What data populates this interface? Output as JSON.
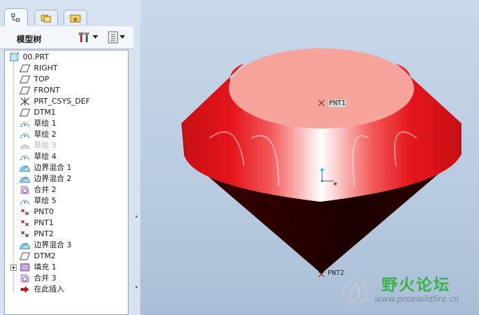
{
  "tree_panel": {
    "title": "模型树",
    "tabs": [
      {
        "name": "model-tree-tab"
      },
      {
        "name": "folder-browser-tab"
      },
      {
        "name": "favorites-tab"
      }
    ],
    "items": [
      {
        "label": "00.PRT",
        "icon": "part-icon",
        "dim": false
      },
      {
        "label": "RIGHT",
        "icon": "datum-plane-icon",
        "dim": false
      },
      {
        "label": "TOP",
        "icon": "datum-plane-icon",
        "dim": false
      },
      {
        "label": "FRONT",
        "icon": "datum-plane-icon",
        "dim": false
      },
      {
        "label": "PRT_CSYS_DEF",
        "icon": "csys-icon",
        "dim": false
      },
      {
        "label": "DTM1",
        "icon": "datum-plane-icon",
        "dim": false
      },
      {
        "label": "草绘 1",
        "icon": "sketch-icon",
        "dim": false
      },
      {
        "label": "草绘 2",
        "icon": "sketch-icon",
        "dim": false
      },
      {
        "label": "草绘 3",
        "icon": "sketch-icon",
        "dim": true
      },
      {
        "label": "草绘 4",
        "icon": "sketch-icon",
        "dim": false
      },
      {
        "label": "边界混合 1",
        "icon": "boundary-blend-icon",
        "dim": false
      },
      {
        "label": "边界混合 2",
        "icon": "boundary-blend-icon",
        "dim": false
      },
      {
        "label": "合并 2",
        "icon": "merge-icon",
        "dim": false
      },
      {
        "label": "草绘 5",
        "icon": "sketch-icon",
        "dim": false
      },
      {
        "label": "PNT0",
        "icon": "datum-point-icon",
        "dim": false
      },
      {
        "label": "PNT1",
        "icon": "datum-point-icon",
        "dim": false
      },
      {
        "label": "PNT2",
        "icon": "datum-point-icon",
        "dim": false
      },
      {
        "label": "边界混合 3",
        "icon": "boundary-blend-icon",
        "dim": false
      },
      {
        "label": "DTM2",
        "icon": "datum-plane-icon",
        "dim": false
      },
      {
        "label": "填充 1",
        "icon": "fill-icon",
        "dim": false,
        "expandable": true
      },
      {
        "label": "合并 3",
        "icon": "merge-icon",
        "dim": false
      },
      {
        "label": "在此插入",
        "icon": "insert-here-arrow-icon",
        "dim": false
      }
    ]
  },
  "viewport": {
    "point_labels": {
      "top": "PNT1",
      "bottom": "PNT2"
    }
  },
  "watermark": {
    "title": "野火论坛",
    "url": "www.proewildfire.cn"
  },
  "colors": {
    "panel_bg": "#d7e2f0",
    "viewport_bg": "#c9d8ea",
    "model_red": "#e0141a",
    "model_top_face": "#f5a39b",
    "model_dark": "#2a0000",
    "watermark_green": "#39b24a"
  }
}
